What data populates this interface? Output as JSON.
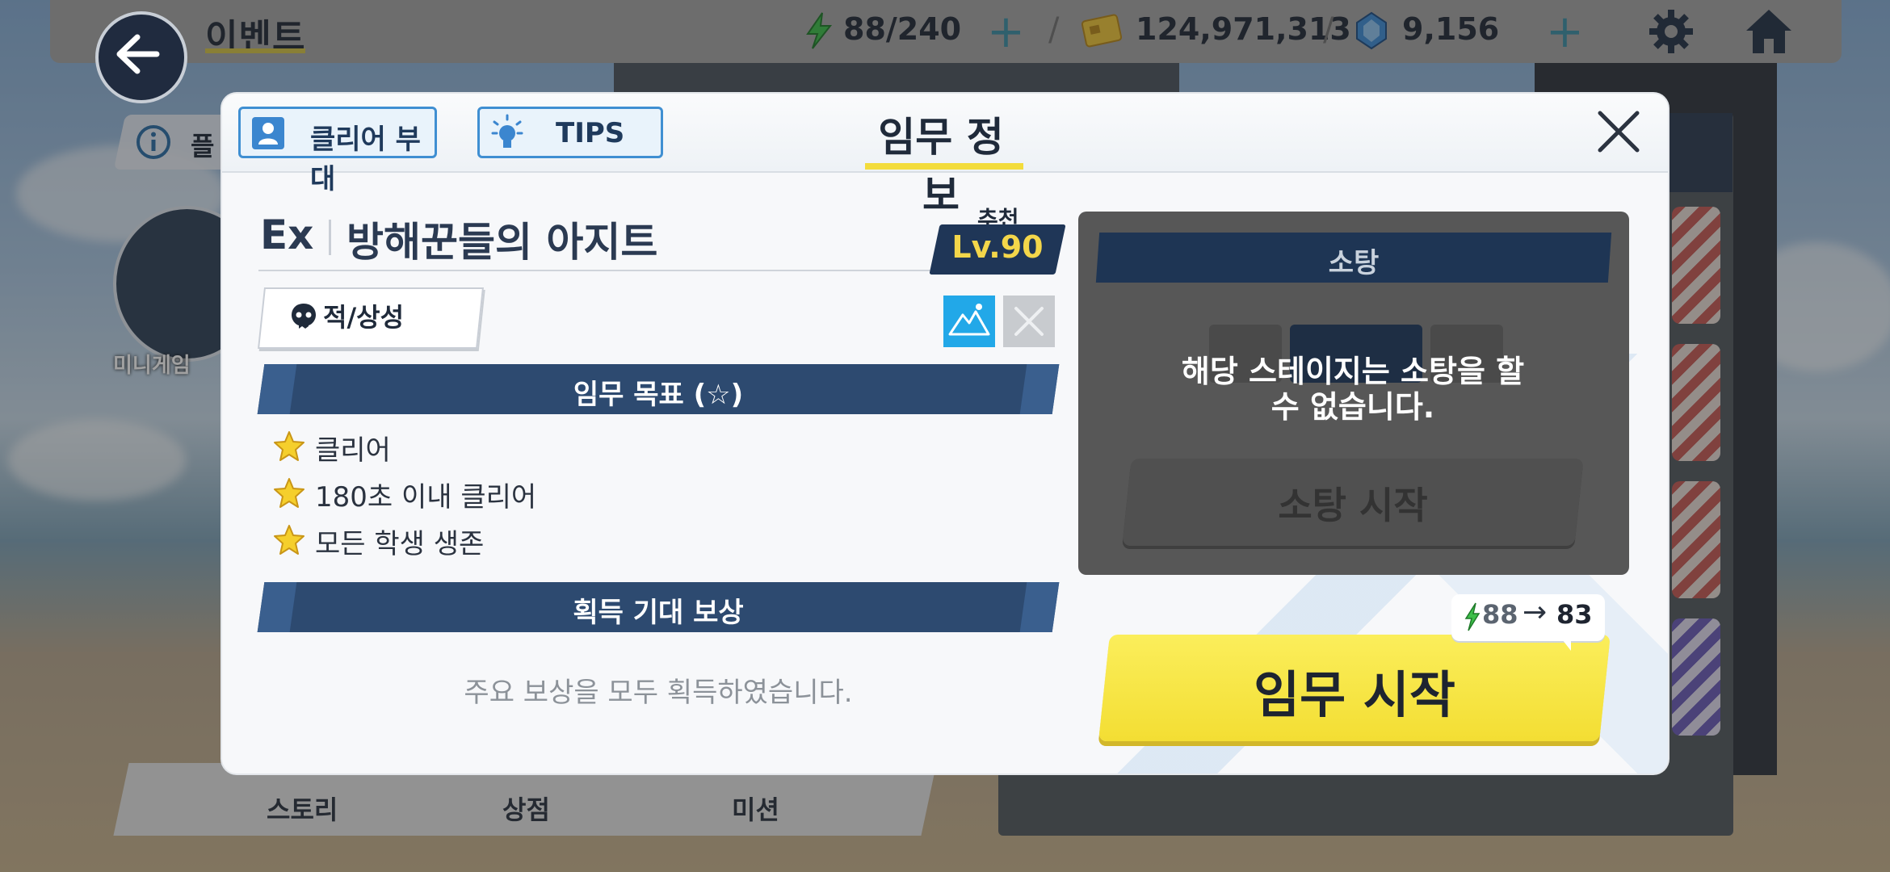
{
  "topbar": {
    "title": "이벤트",
    "ap": "88/240",
    "credits": "124,971,313",
    "gems": "9,156",
    "back_icon": "back-arrow-icon",
    "settings_icon": "gear-icon",
    "home_icon": "home-icon"
  },
  "background": {
    "info_label": "플",
    "event_label": "미니게임",
    "nav": [
      "스토리",
      "상점",
      "미션"
    ]
  },
  "dialog": {
    "title": "임무 정보",
    "clear_squad_label": "클리어 부대",
    "tips_label": "TIPS",
    "difficulty": "Ex",
    "stage_name": "방해꾼들의 아지트",
    "recommend_label": "추천",
    "recommend_level": "Lv.90",
    "enemy_button_label": "적/상성",
    "objectives_title": "임무 목표 (☆)",
    "objectives": [
      "클리어",
      "180초 이내 클리어",
      "모든 학생 생존"
    ],
    "rewards_title": "획득 기대 보상",
    "rewards_empty": "주요 보상을 모두 획득하였습니다.",
    "sweep": {
      "title": "소탕",
      "message_line1": "해당 스테이지는 소탕을 할",
      "message_line2": "수 없습니다.",
      "start_label": "소탕 시작"
    },
    "start_label": "임무 시작",
    "ap_from": "88",
    "ap_to": "83"
  },
  "colors": {
    "accent_yellow": "#f3de33",
    "navy": "#2d4a70",
    "blue": "#3f8fd2"
  }
}
